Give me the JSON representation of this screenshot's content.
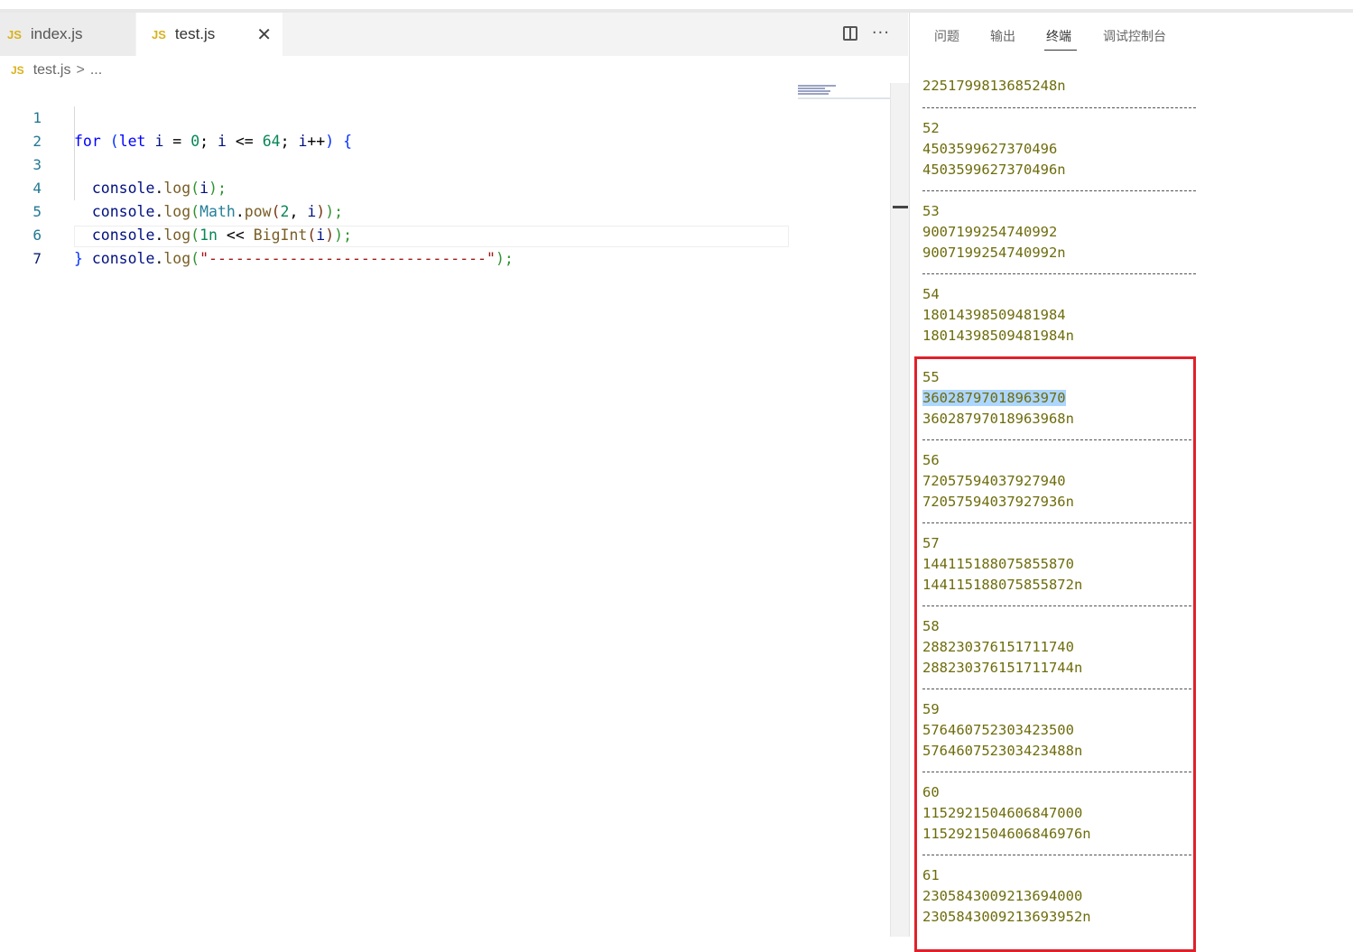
{
  "editor": {
    "tabs": [
      {
        "badge": "JS",
        "label": "index.js"
      },
      {
        "badge": "JS",
        "label": "test.js",
        "close": "✕"
      }
    ],
    "actions": {
      "more": "···"
    },
    "breadcrumb": {
      "badge": "JS",
      "file": "test.js",
      "sep": ">",
      "rest": "..."
    },
    "line_numbers": [
      "1",
      "2",
      "3",
      "4",
      "5",
      "6",
      "7"
    ],
    "code": {
      "l1": {
        "kw_for": "for",
        "paren_open": "(",
        "kw_let": "let",
        "var_i": "i",
        "eq": " = ",
        "zero": "0",
        "semi1": "; ",
        "var_i2": "i",
        "lte": " <= ",
        "n64": "64",
        "semi2": "; ",
        "var_i3": "i",
        "inc": "++",
        "paren_close": ")",
        "brace_open": "{"
      },
      "l2": {
        "console": "console",
        "dot": ".",
        "log": "log",
        "po": "(",
        "arg": "i",
        "pc": ");"
      },
      "l3": {
        "console": "console",
        "dot": ".",
        "log": "log",
        "po": "(",
        "math": "Math",
        "dot2": ".",
        "pow": "pow",
        "po2": "(",
        "two": "2",
        "comma": ", ",
        "arg": "i",
        "pc2": ")",
        "pc": ");"
      },
      "l4": {
        "console": "console",
        "dot": ".",
        "log": "log",
        "po": "(",
        "one_n": "1n",
        "shl": " << ",
        "bigint": "BigInt",
        "po2": "(",
        "arg": "i",
        "pc2": ")",
        "pc": ");"
      },
      "l5": {
        "console": "console",
        "dot": ".",
        "log": "log",
        "po": "(",
        "str": "\"-------------------------------\"",
        "pc": ");"
      },
      "l6": {
        "brace_close": "}"
      }
    }
  },
  "panel": {
    "tabs": [
      "问题",
      "输出",
      "终端",
      "调试控制台"
    ],
    "active_tab": "终端",
    "terminal": {
      "top_line": "2251799813685248n",
      "separator": "--------------------------------",
      "blocks": [
        {
          "i": "52",
          "pow": "4503599627370496",
          "big": "4503599627370496n"
        },
        {
          "i": "53",
          "pow": "9007199254740992",
          "big": "9007199254740992n"
        },
        {
          "i": "54",
          "pow": "18014398509481984",
          "big": "18014398509481984n"
        },
        {
          "i": "55",
          "pow": "36028797018963970",
          "big": "36028797018963968n"
        },
        {
          "i": "56",
          "pow": "72057594037927940",
          "big": "72057594037927936n"
        },
        {
          "i": "57",
          "pow": "144115188075855870",
          "big": "144115188075855872n"
        },
        {
          "i": "58",
          "pow": "288230376151711740",
          "big": "288230376151711744n"
        },
        {
          "i": "59",
          "pow": "576460752303423500",
          "big": "576460752303423488n"
        },
        {
          "i": "60",
          "pow": "1152921504606847000",
          "big": "1152921504606846976n"
        },
        {
          "i": "61",
          "pow": "2305843009213694000",
          "big": "2305843009213693952n"
        }
      ]
    }
  },
  "colors": {
    "highlight_box": "#e0202a",
    "selection": "#add6ff",
    "terminal_text": "#6e6c0c"
  }
}
